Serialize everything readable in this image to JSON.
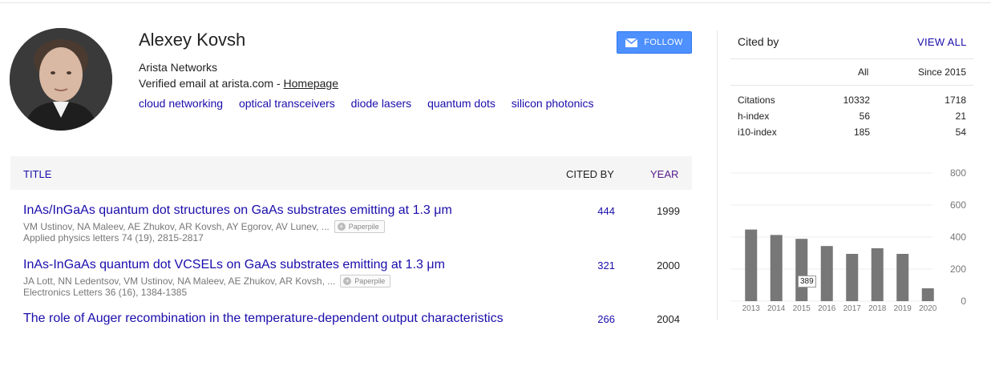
{
  "profile": {
    "name": "Alexey Kovsh",
    "affiliation": "Arista Networks",
    "email_text": "Verified email at arista.com - ",
    "homepage_label": "Homepage",
    "interests": [
      "cloud networking",
      "optical transceivers",
      "diode lasers",
      "quantum dots",
      "silicon photonics"
    ],
    "follow_label": "FOLLOW"
  },
  "table": {
    "col_title": "TITLE",
    "col_cited": "CITED BY",
    "col_year": "YEAR",
    "articles": [
      {
        "title": "InAs/InGaAs quantum dot structures on GaAs substrates emitting at 1.3 μm",
        "authors": "VM Ustinov, NA Maleev, AE Zhukov, AR Kovsh, AY Egorov, AV Lunev, ...",
        "venue": "Applied physics letters 74 (19), 2815-2817",
        "cited_by": "444",
        "year": "1999",
        "paperpile": "Paperpile"
      },
      {
        "title": "InAs-InGaAs quantum dot VCSELs on GaAs substrates emitting at 1.3 μm",
        "authors": "JA Lott, NN Ledentsov, VM Ustinov, NA Maleev, AE Zhukov, AR Kovsh, ...",
        "venue": "Electronics Letters 36 (16), 1384-1385",
        "cited_by": "321",
        "year": "2000",
        "paperpile": "Paperpile"
      },
      {
        "title": "The role of Auger recombination in the temperature-dependent output characteristics",
        "cited_by": "266",
        "year": "2004"
      }
    ]
  },
  "cited_by": {
    "title": "Cited by",
    "view_all": "VIEW ALL",
    "col_all": "All",
    "col_since": "Since 2015",
    "rows": [
      {
        "label": "Citations",
        "all": "10332",
        "since": "1718"
      },
      {
        "label": "h-index",
        "all": "56",
        "since": "21"
      },
      {
        "label": "i10-index",
        "all": "185",
        "since": "54"
      }
    ]
  },
  "chart_data": {
    "type": "bar",
    "categories": [
      "2013",
      "2014",
      "2015",
      "2016",
      "2017",
      "2018",
      "2019",
      "2020"
    ],
    "values": [
      447,
      413,
      389,
      344,
      295,
      330,
      295,
      80
    ],
    "yticks": [
      0,
      200,
      400,
      600,
      800
    ],
    "ylim": [
      0,
      800
    ],
    "tooltip": "389",
    "bar_color": "#777777"
  },
  "colors": {
    "link": "#1a0dab",
    "accent": "#4d90fe"
  }
}
